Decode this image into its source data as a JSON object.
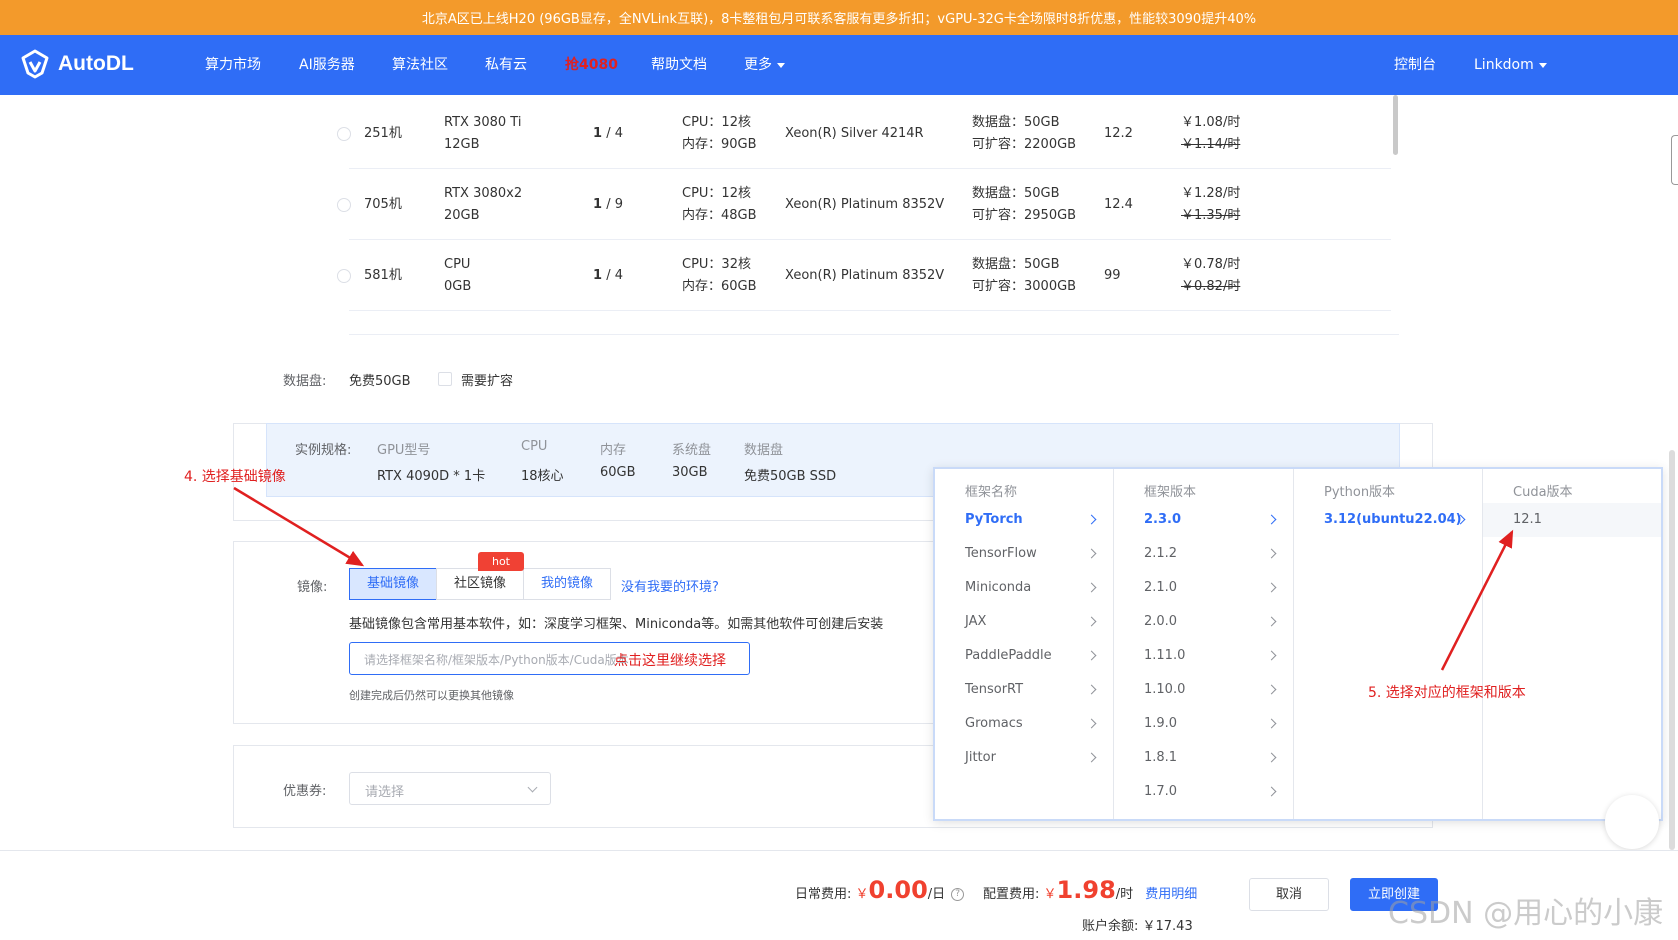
{
  "banner": {
    "text": "北京A区已上线H20 (96GB显存，全NVLink互联)，8卡整租包月可联系客服有更多折扣；vGPU-32G卡全场限时8折优惠，性能较3090提升40%"
  },
  "nav": {
    "brand": "AutoDL",
    "items": [
      "算力市场",
      "AI服务器",
      "算法社区",
      "私有云",
      "抢4080",
      "帮助文档",
      "更多"
    ],
    "console": "控制台",
    "user": "Linkdom"
  },
  "machines": [
    {
      "name": "251机",
      "gpu": "RTX 3080 Ti",
      "vram": "12GB",
      "free": "1",
      "total": "/ 4",
      "cpu": "CPU：12核",
      "mem": "内存：90GB",
      "cpu_model": "Xeon(R) Silver 4214R",
      "disk": "数据盘：50GB",
      "expand": "可扩容：2200GB",
      "cuda": "12.2",
      "price": "￥1.08/时",
      "old_price": "￥1.14/时"
    },
    {
      "name": "705机",
      "gpu": "RTX 3080x2",
      "vram": "20GB",
      "free": "1",
      "total": "/ 9",
      "cpu": "CPU：12核",
      "mem": "内存：48GB",
      "cpu_model": "Xeon(R) Platinum 8352V",
      "disk": "数据盘：50GB",
      "expand": "可扩容：2950GB",
      "cuda": "12.4",
      "price": "￥1.28/时",
      "old_price": "￥1.35/时"
    },
    {
      "name": "581机",
      "gpu": "CPU",
      "vram": "0GB",
      "free": "1",
      "total": "/ 4",
      "cpu": "CPU：32核",
      "mem": "内存：60GB",
      "cpu_model": "Xeon(R) Platinum 8352V",
      "disk": "数据盘：50GB",
      "expand": "可扩容：3000GB",
      "cuda": "99",
      "price": "￥0.78/时",
      "old_price": "￥0.82/时"
    }
  ],
  "data_disk": {
    "label": "数据盘:",
    "value": "免费50GB",
    "expand_label": "需要扩容"
  },
  "spec": {
    "label": "实例规格:",
    "headers": [
      "GPU型号",
      "CPU",
      "内存",
      "系统盘",
      "数据盘"
    ],
    "values": [
      "RTX 4090D * 1卡",
      "18核心",
      "60GB",
      "30GB",
      "免费50GB SSD"
    ]
  },
  "image": {
    "label": "镜像:",
    "tabs": [
      "基础镜像",
      "社区镜像",
      "我的镜像"
    ],
    "hot": "hot",
    "missing_link": "没有我要的环境?",
    "desc": "基础镜像包含常用基本软件，如：深度学习框架、Miniconda等。如需其他软件可创建后安装",
    "placeholder": "请选择框架名称/框架版本/Python版本/Cuda版本",
    "hint": "创建完成后仍然可以更换其他镜像",
    "input_note": "点击这里继续选择"
  },
  "coupon": {
    "label": "优惠券:",
    "placeholder": "请选择"
  },
  "cascader": {
    "headers": [
      "框架名称",
      "框架版本",
      "Python版本",
      "Cuda版本"
    ],
    "frameworks": [
      "PyTorch",
      "TensorFlow",
      "Miniconda",
      "JAX",
      "PaddlePaddle",
      "TensorRT",
      "Gromacs",
      "Jittor"
    ],
    "versions": [
      "2.3.0",
      "2.1.2",
      "2.1.0",
      "2.0.0",
      "1.11.0",
      "1.10.0",
      "1.9.0",
      "1.8.1",
      "1.7.0"
    ],
    "python": [
      "3.12(ubuntu22.04)"
    ],
    "cuda": [
      "12.1"
    ]
  },
  "annotations": {
    "step4": "4. 选择基础镜像",
    "step5": "5. 选择对应的框架和版本"
  },
  "footer": {
    "daily_label": "日常费用:",
    "daily_currency": "￥",
    "daily_value": "0.00",
    "daily_unit": "/日",
    "config_label": "配置费用:",
    "config_currency": "￥",
    "config_value": "1.98",
    "config_unit": "/时",
    "detail_link": "费用明细",
    "balance": "账户余额: ￥17.43",
    "cancel": "取消",
    "create": "立即创建"
  },
  "watermark": "CSDN @用心的小康",
  "colors": {
    "primary": "#2f6df6",
    "banner": "#f39a2b",
    "price": "#f0412f",
    "annotation": "#e02020"
  }
}
